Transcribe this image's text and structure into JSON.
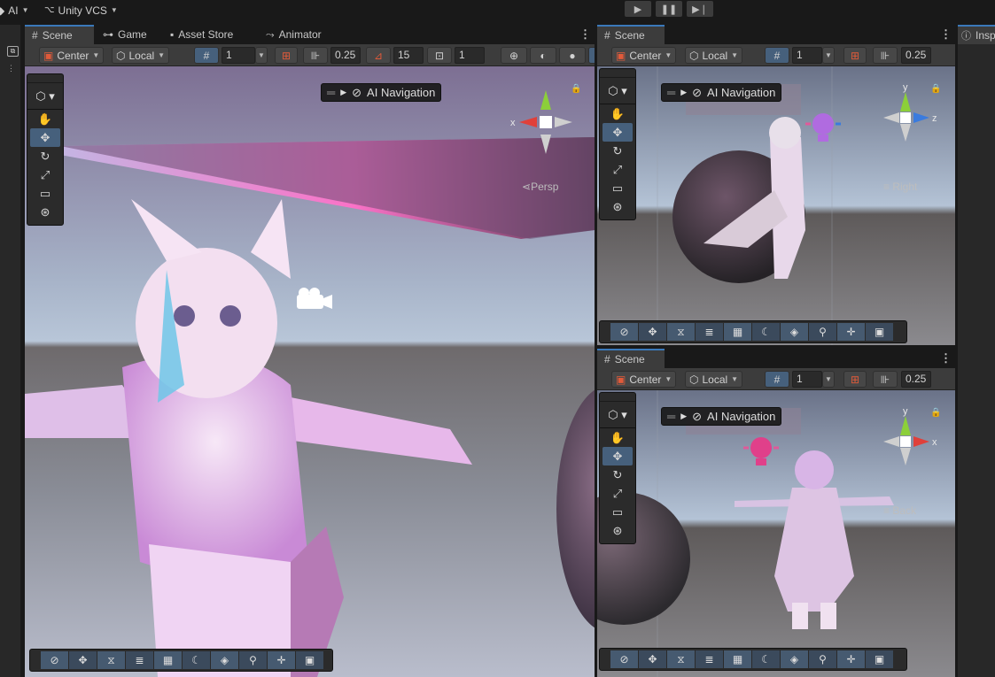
{
  "topbar": {
    "account_label": "AI",
    "vcs_label": "Unity VCS",
    "play_icon": "play-icon",
    "pause_icon": "pause-icon",
    "step_icon": "step-icon"
  },
  "main_panel": {
    "tabs": [
      {
        "icon": "grid-icon",
        "label": "Scene"
      },
      {
        "icon": "gamepad-icon",
        "label": "Game"
      },
      {
        "icon": "bag-icon",
        "label": "Asset Store"
      },
      {
        "icon": "animator-icon",
        "label": "Animator"
      }
    ],
    "toolbar": {
      "pivot": "Center",
      "space": "Local",
      "grid_value": "1",
      "snap_move": "0.25",
      "snap_rotate": "15",
      "snap_scale": "1"
    },
    "overlay_title": "AI Navigation",
    "view_label": "Persp",
    "axis_x": "x"
  },
  "right_top_panel": {
    "tab": "Scene",
    "toolbar": {
      "pivot": "Center",
      "space": "Local",
      "grid_value": "1",
      "snap_move": "0.25"
    },
    "overlay_title": "AI Navigation",
    "view_label": "Right",
    "axis_y": "y",
    "axis_z": "z"
  },
  "right_bottom_panel": {
    "tab": "Scene",
    "toolbar": {
      "pivot": "Center",
      "space": "Local",
      "grid_value": "1",
      "snap_move": "0.25"
    },
    "overlay_title": "AI Navigation",
    "view_label": "Back",
    "axis_y": "y",
    "axis_x": "x"
  },
  "inspector_tab": "Insp",
  "colors": {
    "accent": "#3a79bb",
    "selected_tool": "#46607c",
    "panel_bg": "#282828",
    "toolbar_bg": "#3c3c3c",
    "axis_x": "#e0403a",
    "axis_y": "#8ccf3a",
    "axis_z": "#3a7bde"
  }
}
